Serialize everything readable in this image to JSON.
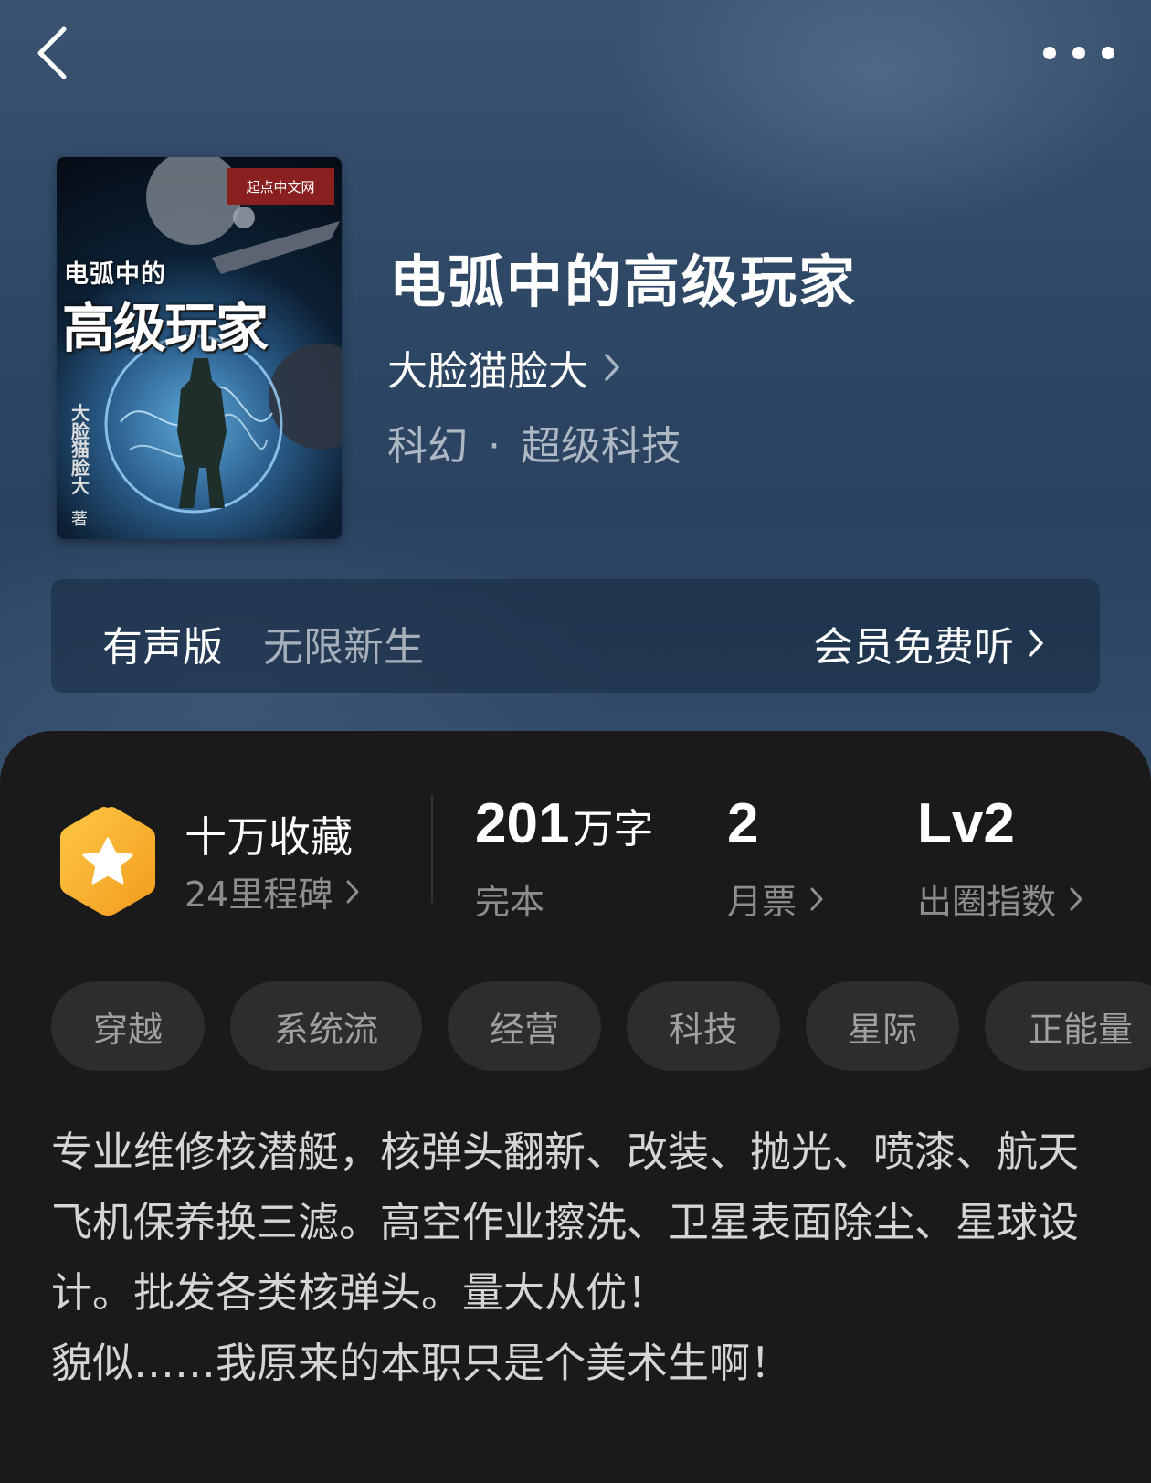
{
  "nav": {
    "back_icon": "chevron-left-icon",
    "more_icon": "more-horizontal-icon"
  },
  "cover": {
    "publisher_badge": "起点中文网",
    "title_small": "电弧中的",
    "title_big": "高级玩家",
    "author_vertical": "大脸猫脸大",
    "author_suffix": "著"
  },
  "book": {
    "title": "电弧中的高级玩家",
    "author": "大脸猫脸大",
    "category": "科幻",
    "separator": "·",
    "subcategory": "超级科技"
  },
  "audio": {
    "label": "有声版",
    "narrator": "无限新生",
    "cta": "会员免费听"
  },
  "stats": {
    "collect_main": "十万收藏",
    "collect_sub": "24里程碑",
    "words_value": "201",
    "words_unit": "万字",
    "words_label": "完本",
    "tickets_value": "2",
    "tickets_label": "月票",
    "index_value": "Lv2",
    "index_label": "出圈指数"
  },
  "tags": [
    "穿越",
    "系统流",
    "经营",
    "科技",
    "星际",
    "正能量"
  ],
  "synopsis": "专业维修核潜艇，核弹头翻新、改装、抛光、喷漆、航天飞机保养换三滤。高空作业擦洗、卫星表面除尘、星球设计。批发各类核弹头。量大从优！\n貌似……我原来的本职只是个美术生啊！",
  "colors": {
    "header_bg": "#2e4866",
    "panel_bg": "#1a1a1a",
    "tag_bg": "#2d2d2d",
    "badge_orange": "#f5a623"
  }
}
